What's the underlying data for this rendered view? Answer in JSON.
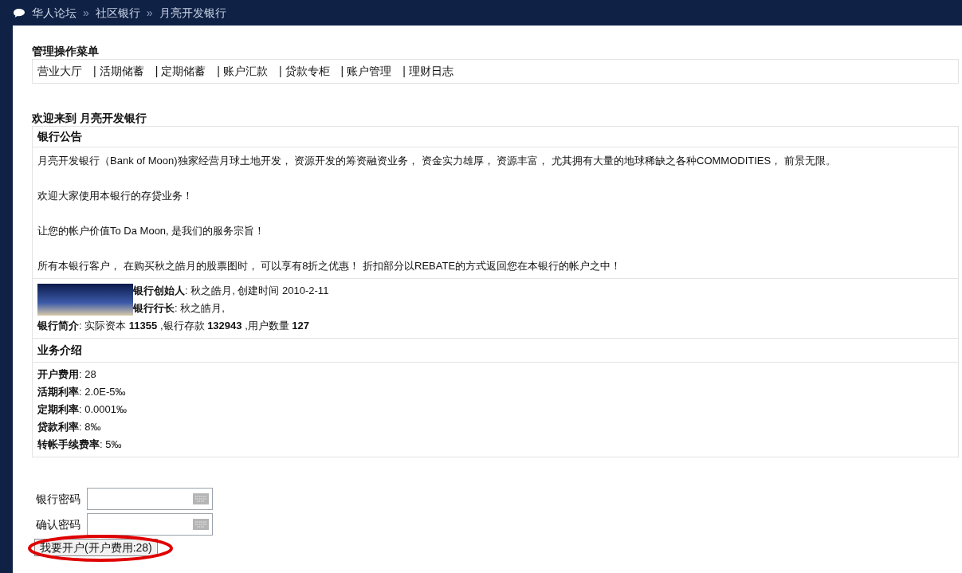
{
  "breadcrumb": {
    "separator": "»",
    "items": [
      "华人论坛",
      "社区银行",
      "月亮开发银行"
    ]
  },
  "menu": {
    "title": "管理操作菜单",
    "separator": "|",
    "items": [
      "营业大厅",
      "活期储蓄",
      "定期储蓄",
      "账户汇款",
      "贷款专柜",
      "账户管理",
      "理财日志"
    ]
  },
  "welcome": "欢迎来到 月亮开发银行",
  "notice": {
    "title": "银行公告",
    "paragraphs": [
      "月亮开发银行（Bank of Moon)独家经营月球土地开发， 资源开发的筹资融资业务， 资金实力雄厚， 资源丰富， 尤其拥有大量的地球稀缺之各种COMMODITIES， 前景无限。",
      "欢迎大家使用本银行的存贷业务！",
      "让您的帐户价值To Da Moon, 是我们的服务宗旨！",
      "所有本银行客户， 在购买秋之皓月的股票图时， 可以享有8折之优惠！ 折扣部分以REBATE的方式返回您在本银行的帐户之中！"
    ]
  },
  "bank_info": {
    "founder": "**银行创始人**: 秋之皓月, 创建时间 2010-2-11",
    "president": "**银行行长**: 秋之皓月,",
    "intro": "**银行简介**: 实际资本 **11355** ,银行存款 **132943** ,用户数量 **127**"
  },
  "business": {
    "title": "业务介绍",
    "lines": [
      "**开户费用**: 28",
      "**活期利率**: 2.0E-5‰",
      "**定期利率**: 0.0001‰",
      "**贷款利率**: 8‰",
      "**转帐手续费率**: 5‰"
    ]
  },
  "form": {
    "fields": [
      {
        "label": "银行密码"
      },
      {
        "label": "确认密码"
      }
    ],
    "button": "我要开户(开户费用:28)"
  }
}
